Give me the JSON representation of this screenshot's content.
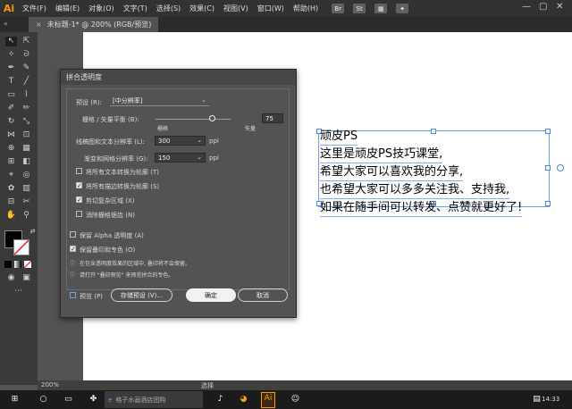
{
  "app": {
    "logo": "Ai"
  },
  "menu": [
    "文件(F)",
    "编辑(E)",
    "对象(O)",
    "文字(T)",
    "选择(S)",
    "效果(C)",
    "视图(V)",
    "窗口(W)",
    "帮助(H)"
  ],
  "menubar_buttons": [
    "Br",
    "St"
  ],
  "window_controls": {
    "minimize": "—",
    "restore": "▢",
    "close": "✕"
  },
  "tab": {
    "title": "未标题-1* @ 200% (RGB/预览)",
    "close": "×"
  },
  "toolbar_collapse": "«",
  "canvas": {
    "lines": [
      "顽皮PS",
      "这里是顽皮PS技巧课堂,",
      "希望大家可以喜欢我的分享,",
      "也希望大家可以多多关注我、支持我,",
      "如果在随手间可以转发、点赞就更好了!"
    ]
  },
  "status": {
    "zoom": "200%",
    "mode": "选择"
  },
  "dialog": {
    "title": "拼合透明度",
    "preset_label": "预设 (R):",
    "preset_value": "[中分辨率]",
    "slider_label": "栅格 / 矢量平衡 (B):",
    "slider_left": "栅格",
    "slider_right": "矢量",
    "slider_value": "75",
    "slider_level": 75,
    "line_res_label": "线稿图和文本分辨率 (L):",
    "line_res_value": "300",
    "grad_res_label": "渐变和网格分辨率 (G):",
    "grad_res_value": "150",
    "unit": "ppi",
    "options": [
      {
        "label": "将所有文本转换为轮廓 (T)",
        "checked": false
      },
      {
        "label": "将所有描边转换为轮廓 (S)",
        "checked": true
      },
      {
        "label": "剪切复杂区域 (X)",
        "checked": true
      },
      {
        "label": "消除栅格锯齿 (N)",
        "checked": false
      }
    ],
    "keep_alpha": {
      "label": "保留 Alpha 透明度 (A)",
      "checked": false
    },
    "keep_overprint": {
      "label": "保留叠印和专色 (O)",
      "checked": true
    },
    "info": [
      "在包含透明度效果的区域中, 叠印将不会保留。",
      "请打开 \"叠印预览\" 来预览拼合的专色。"
    ],
    "preview": {
      "label": "预览 (P)",
      "checked": false
    },
    "save_preset": "存储预设 (V)...",
    "ok": "确定",
    "cancel": "取消"
  },
  "taskbar": {
    "search_placeholder": "格子水画酒店团购",
    "time": "14:33"
  },
  "colors": {
    "accent": "#ff9a00",
    "selection": "#4a86d9",
    "fill_swatch": "#000000",
    "stroke_swatch": "#ffffff",
    "none_swatch": "#e02020"
  }
}
